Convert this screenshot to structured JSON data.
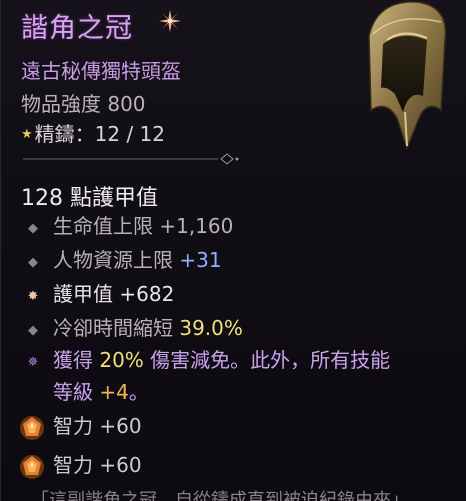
{
  "item": {
    "name": "諧角之冠",
    "type": "遠古秘傳獨特頭盔",
    "item_power_label": "物品強度 800",
    "masterwork_label": "精鑄：12 / 12"
  },
  "armor_label": "128 點護甲值",
  "stats": [
    {
      "label": "生命值上限",
      "value": "+1,160"
    },
    {
      "label": "人物資源上限",
      "value": "+31"
    },
    {
      "label": "護甲值",
      "value": "+682"
    },
    {
      "label": "冷卻時間縮短",
      "value": "39.0%"
    }
  ],
  "aspect": {
    "prefix": "獲得",
    "percent": "20%",
    "mid": "傷害減免。此外，所有技能",
    "line2_prefix": "等級",
    "bonus": "+4",
    "line2_suffix": "。"
  },
  "gems": [
    {
      "label": "智力 +60"
    },
    {
      "label": "智力 +60"
    }
  ],
  "footer_partial": "「這副諧角之冠…自從鑄成直到被迫紀錄由來」"
}
